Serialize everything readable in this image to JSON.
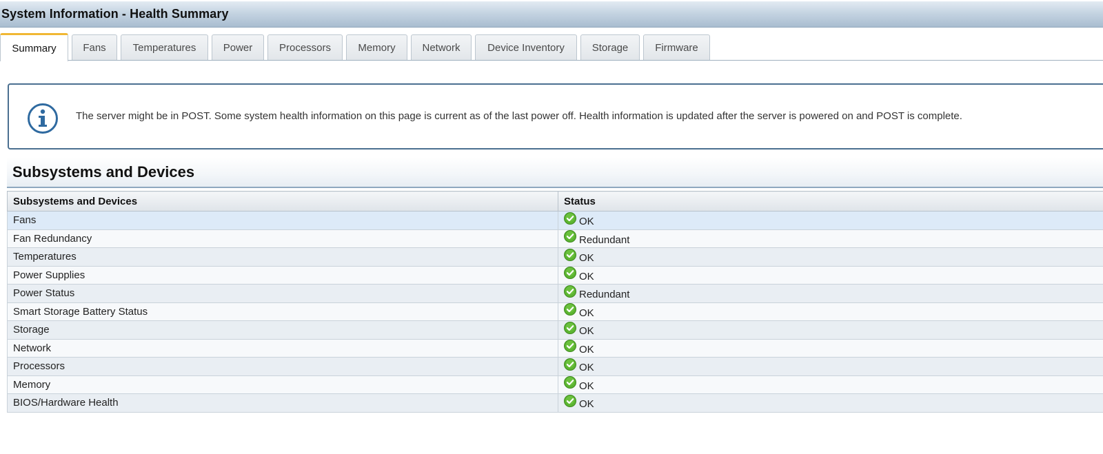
{
  "window": {
    "title": "System Information - Health Summary"
  },
  "tabs": [
    {
      "label": "Summary",
      "active": true
    },
    {
      "label": "Fans",
      "active": false
    },
    {
      "label": "Temperatures",
      "active": false
    },
    {
      "label": "Power",
      "active": false
    },
    {
      "label": "Processors",
      "active": false
    },
    {
      "label": "Memory",
      "active": false
    },
    {
      "label": "Network",
      "active": false
    },
    {
      "label": "Device Inventory",
      "active": false
    },
    {
      "label": "Storage",
      "active": false
    },
    {
      "label": "Firmware",
      "active": false
    }
  ],
  "notice": {
    "icon": "info-icon",
    "text": "The server might be in POST. Some system health information on this page is current as of the last power off. Health information is updated after the server is powered on and POST is complete."
  },
  "section": {
    "title": "Subsystems and Devices"
  },
  "table": {
    "columns": [
      "Subsystems and Devices",
      "Status"
    ],
    "status_icon": "check-circle-icon",
    "status_color": "#5cb531",
    "rows": [
      {
        "name": "Fans",
        "status": "OK"
      },
      {
        "name": "Fan Redundancy",
        "status": "Redundant"
      },
      {
        "name": "Temperatures",
        "status": "OK"
      },
      {
        "name": "Power Supplies",
        "status": "OK"
      },
      {
        "name": "Power Status",
        "status": "Redundant"
      },
      {
        "name": "Smart Storage Battery Status",
        "status": "OK"
      },
      {
        "name": "Storage",
        "status": "OK"
      },
      {
        "name": "Network",
        "status": "OK"
      },
      {
        "name": "Processors",
        "status": "OK"
      },
      {
        "name": "Memory",
        "status": "OK"
      },
      {
        "name": "BIOS/Hardware Health",
        "status": "OK"
      }
    ]
  },
  "colors": {
    "accent_tab": "#f0b733",
    "title_bar": "#c5d4e2",
    "info_border": "#4a6f90",
    "info_icon": "#2f6aa0",
    "row_highlight": "#ddeaf8"
  }
}
